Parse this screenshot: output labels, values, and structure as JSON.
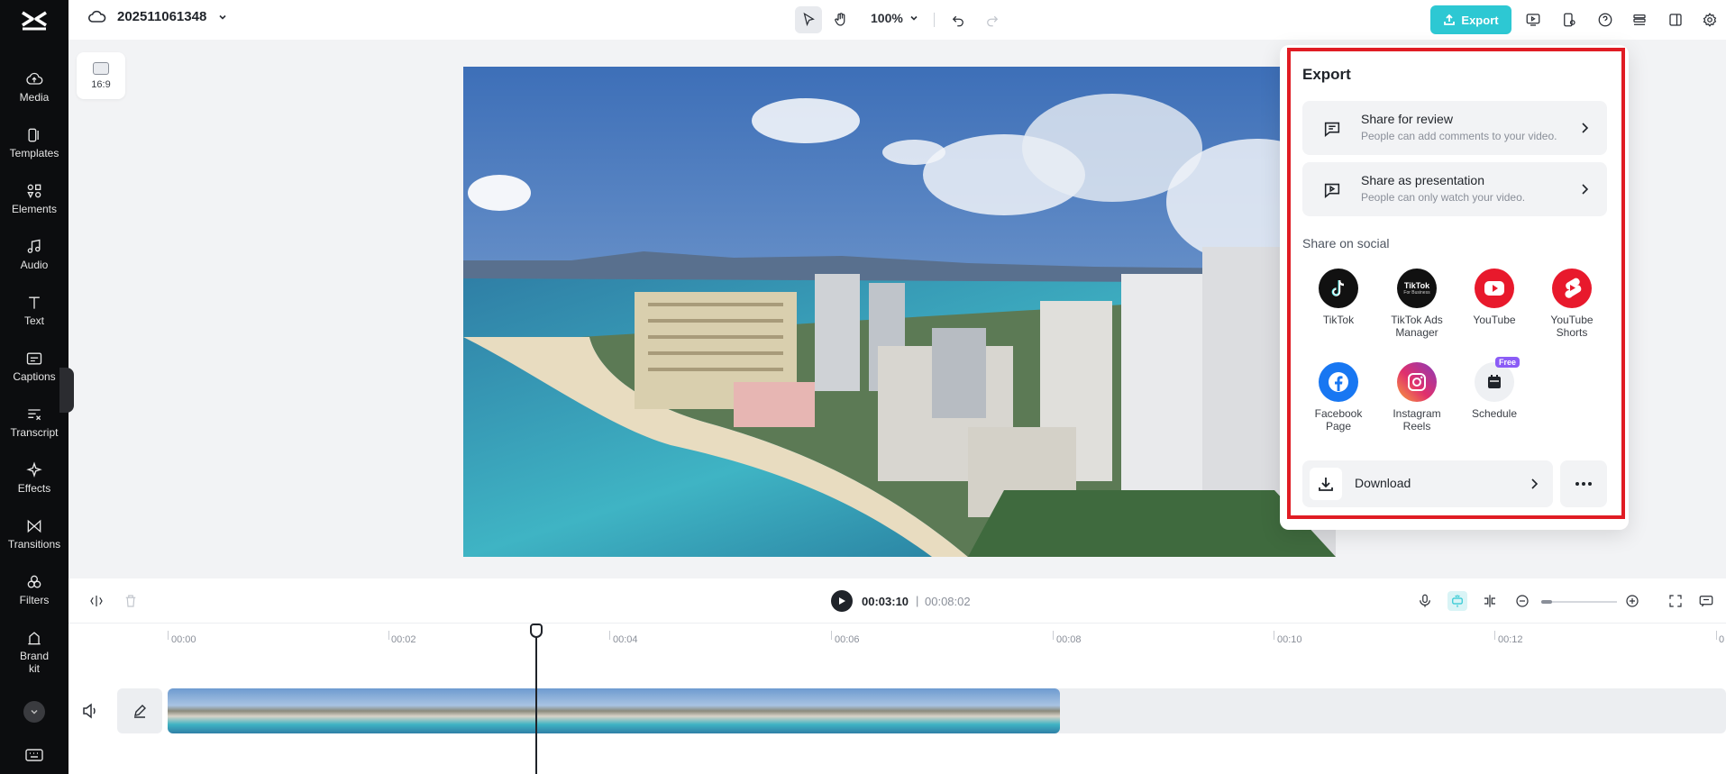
{
  "nav": {
    "items": [
      {
        "label": "Media",
        "icon": "cloud-upload-icon"
      },
      {
        "label": "Templates",
        "icon": "templates-icon"
      },
      {
        "label": "Elements",
        "icon": "elements-icon"
      },
      {
        "label": "Audio",
        "icon": "music-note-icon"
      },
      {
        "label": "Text",
        "icon": "text-icon"
      },
      {
        "label": "Captions",
        "icon": "captions-icon"
      },
      {
        "label": "Transcript",
        "icon": "transcript-icon"
      },
      {
        "label": "Effects",
        "icon": "sparkle-icon"
      },
      {
        "label": "Transitions",
        "icon": "transitions-icon"
      },
      {
        "label": "Filters",
        "icon": "filters-icon"
      },
      {
        "label": "Brand\nkit",
        "icon": "brand-kit-icon"
      }
    ]
  },
  "topbar": {
    "project_name": "202511061348",
    "zoom": "100%",
    "export_label": "Export"
  },
  "canvas": {
    "ratio_label": "16:9"
  },
  "export_panel": {
    "title": "Export",
    "share_review": {
      "title": "Share for review",
      "subtitle": "People can add comments to your video."
    },
    "share_presentation": {
      "title": "Share as presentation",
      "subtitle": "People can only watch your video."
    },
    "social_title": "Share on social",
    "social": [
      {
        "label": "TikTok",
        "icon": "tiktok-icon"
      },
      {
        "label": "TikTok Ads\nManager",
        "icon": "tiktok-ads-icon"
      },
      {
        "label": "YouTube",
        "icon": "youtube-icon"
      },
      {
        "label": "YouTube\nShorts",
        "icon": "youtube-shorts-icon"
      },
      {
        "label": "Facebook\nPage",
        "icon": "facebook-icon"
      },
      {
        "label": "Instagram\nReels",
        "icon": "instagram-icon"
      },
      {
        "label": "Schedule",
        "icon": "calendar-icon",
        "badge": "Free"
      }
    ],
    "tiktok_ads_logo_text": "TikTok",
    "tiktok_ads_logo_sub": "For Business",
    "download_label": "Download"
  },
  "timeline": {
    "current_time": "00:03:10",
    "separator": "|",
    "total_time": "00:08:02",
    "ticks": [
      "00:00",
      "00:02",
      "00:04",
      "00:06",
      "00:08",
      "00:10",
      "00:12",
      "0"
    ]
  },
  "colors": {
    "accent": "#2dc8d3",
    "highlight_outline": "#e01c24",
    "nav_bg": "#0c0d0f"
  }
}
